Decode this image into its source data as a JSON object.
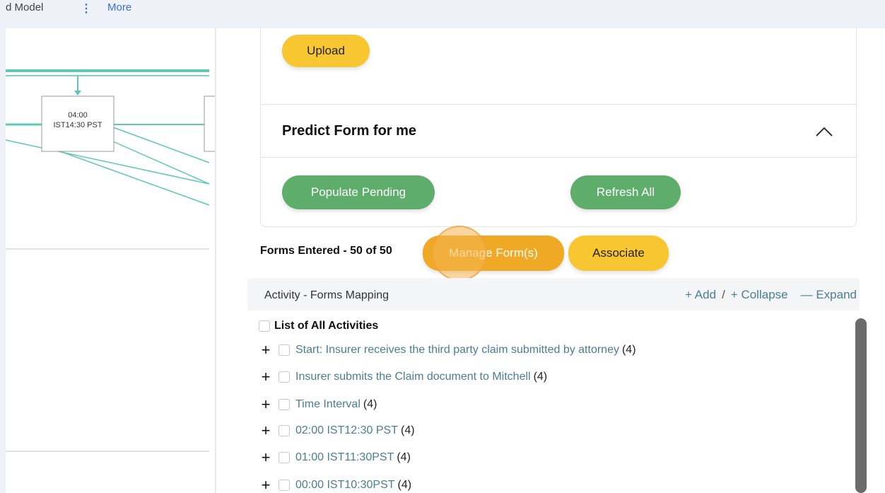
{
  "topnav": {
    "crumb": "d Model",
    "dots": "⋮",
    "more": "More"
  },
  "diagram": {
    "node_label_1": "04:00",
    "node_label_2": "IST14:30 PST"
  },
  "upload": {
    "button_label": "Upload"
  },
  "predict": {
    "title": "Predict Form for me",
    "populate_label": "Populate Pending",
    "refresh_label": "Refresh All"
  },
  "forms": {
    "entered_label": "Forms Entered - 50 of 50",
    "manage_label": "Manage Form(s)",
    "associate_label": "Associate"
  },
  "mapping": {
    "title": "Activity - Forms Mapping",
    "add_label": "+ Add",
    "separator": "/",
    "collapse_label": "+ Collapse",
    "expand_label": "— Expand"
  },
  "tree": {
    "root_label": "List of All Activities",
    "items": [
      {
        "label": "Start: Insurer receives the third party claim submitted by attorney",
        "count": "(4)"
      },
      {
        "label": "Insurer submits the Claim document to Mitchell",
        "count": "(4)"
      },
      {
        "label": "Time Interval",
        "count": "(4)"
      },
      {
        "label": "02:00 IST12:30 PST",
        "count": "(4)"
      },
      {
        "label": "01:00 IST11:30PST",
        "count": "(4)"
      },
      {
        "label": "00:00 IST10:30PST",
        "count": "(4)"
      }
    ]
  },
  "colors": {
    "yellow": "#f8c630",
    "green": "#5ead6b",
    "orange": "#f0a924",
    "teal_link": "#4a7e95",
    "diagram_line": "#5fc7b4"
  },
  "icons": {
    "chevron": "chevron-up-icon",
    "expand": "plus-icon"
  }
}
